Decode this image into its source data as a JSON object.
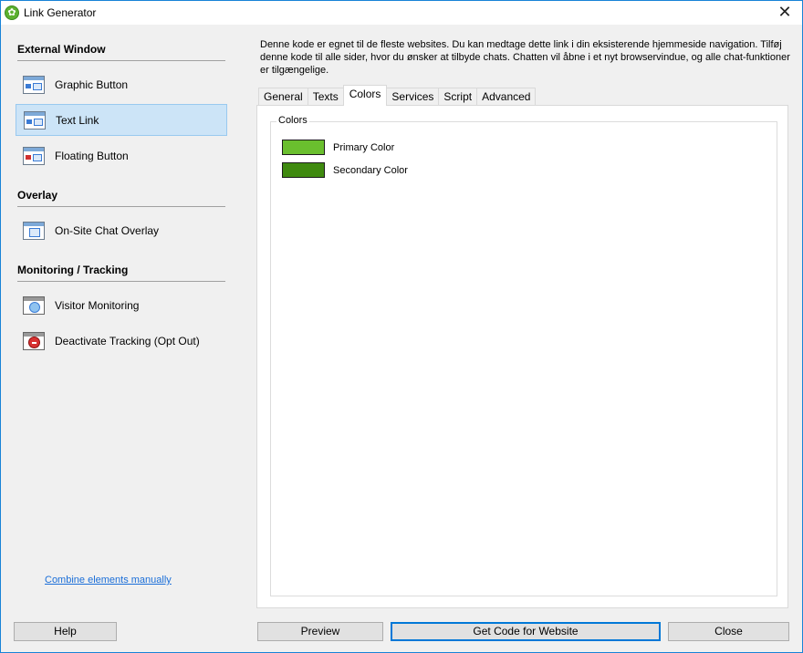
{
  "window": {
    "title": "Link Generator"
  },
  "sidebar": {
    "sections": [
      {
        "title": "External Window"
      },
      {
        "title": "Overlay"
      },
      {
        "title": "Monitoring / Tracking"
      }
    ],
    "items": [
      {
        "label": "Graphic Button",
        "icon": "graphic-button-icon"
      },
      {
        "label": "Text Link",
        "icon": "text-link-icon",
        "selected": true
      },
      {
        "label": "Floating Button",
        "icon": "floating-button-icon"
      },
      {
        "label": "On-Site Chat Overlay",
        "icon": "chat-overlay-icon"
      },
      {
        "label": "Visitor Monitoring",
        "icon": "visitor-monitoring-icon"
      },
      {
        "label": "Deactivate Tracking (Opt Out)",
        "icon": "deactivate-tracking-icon"
      }
    ],
    "combine_link": "Combine elements manually"
  },
  "main": {
    "description": "Denne kode er egnet til de fleste websites. Du kan medtage dette link i din eksisterende hjemmeside navigation. Tilføj denne kode til alle sider, hvor du ønsker at tilbyde chats. Chatten vil åbne i et nyt browservindue, og alle chat-funktioner er tilgængelige.",
    "tabs": [
      {
        "label": "General"
      },
      {
        "label": "Texts"
      },
      {
        "label": "Colors",
        "active": true
      },
      {
        "label": "Services"
      },
      {
        "label": "Script"
      },
      {
        "label": "Advanced"
      }
    ],
    "colors_group": {
      "title": "Colors",
      "primary": {
        "label": "Primary Color",
        "color": "#6abf2e"
      },
      "secondary": {
        "label": "Secondary Color",
        "color": "#3f8a0f"
      }
    }
  },
  "buttons": {
    "help": "Help",
    "preview": "Preview",
    "get_code": "Get Code for Website",
    "close": "Close"
  }
}
